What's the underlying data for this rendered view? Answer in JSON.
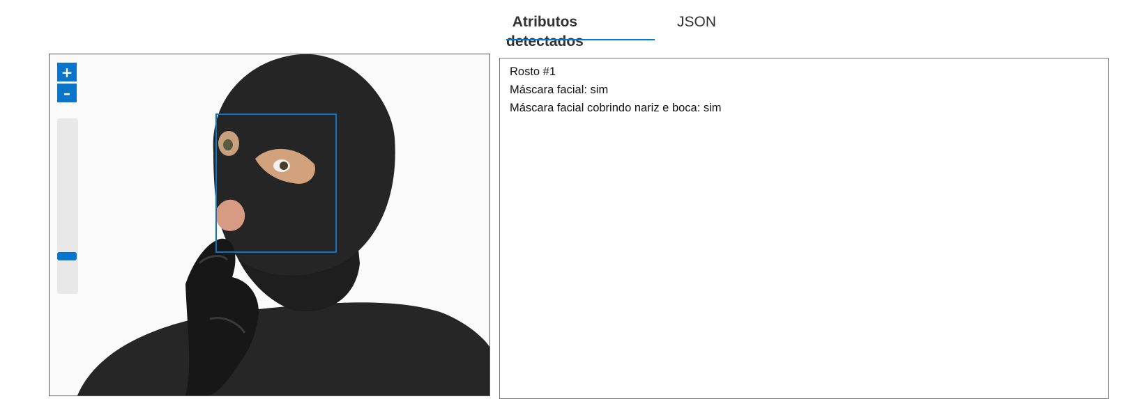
{
  "tabs": [
    {
      "label": "Atributos detectados",
      "active": true
    },
    {
      "label": "JSON",
      "active": false
    }
  ],
  "viewer": {
    "zoom_in_label": "+",
    "zoom_out_label": "–",
    "zoom_level_fraction": 0.2,
    "image_subject": "person-wearing-black-balaclava-and-glove"
  },
  "attributes": {
    "lines": [
      "Rosto #1",
      "Máscara facial: sim",
      "Máscara facial cobrindo nariz e boca: sim"
    ]
  },
  "colors": {
    "accent": "#0a74c9",
    "tab_underline": "#0078d4"
  }
}
